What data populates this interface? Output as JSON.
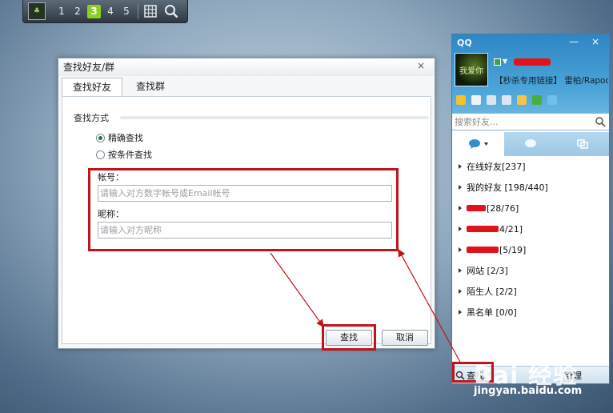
{
  "workspace_switcher": {
    "numbers": [
      "1",
      "2",
      "3",
      "4",
      "5"
    ],
    "active": "3"
  },
  "find_dialog": {
    "title": "查找好友/群",
    "close": "×",
    "tabs": [
      {
        "label": "查找好友",
        "active": true
      },
      {
        "label": "查找群",
        "active": false
      }
    ],
    "method_label": "查找方式",
    "radios": [
      {
        "label": "精确查找",
        "checked": true
      },
      {
        "label": "按条件查找",
        "checked": false
      }
    ],
    "account_label": "帐号：",
    "account_placeholder": "请输入对方数字帐号或Email帐号",
    "nickname_label": "昵称：",
    "nickname_placeholder": "请输入对方昵称",
    "find_button": "查找",
    "cancel_button": "取消"
  },
  "qq_panel": {
    "logo": "QQ",
    "min": "—",
    "close": "×",
    "avatar_text": "我爱你",
    "signature": "【秒杀专用链接】 雷柏/Rapoo",
    "search_placeholder": "搜索好友...",
    "groups": [
      {
        "label": "在线好友[237]"
      },
      {
        "label": "我的好友 [198/440]"
      },
      {
        "label": "[28/76]",
        "redacted_prefix": true
      },
      {
        "label": "4/21]",
        "redacted_prefix": true
      },
      {
        "label": "[5/19]",
        "redacted_prefix": true
      },
      {
        "label": "网站 [2/3]"
      },
      {
        "label": "陌生人 [2/2]"
      },
      {
        "label": "黑名单 [0/0]"
      }
    ],
    "bottom_find": "查找",
    "bottom_manage": "管理"
  },
  "watermark": {
    "logo": "Bai 经验",
    "url": "jingyan.baidu.com"
  },
  "colors": {
    "highlight_red": "#c0141b",
    "qq_blue": "#2f86c4",
    "active_green": "#8ccf24"
  }
}
